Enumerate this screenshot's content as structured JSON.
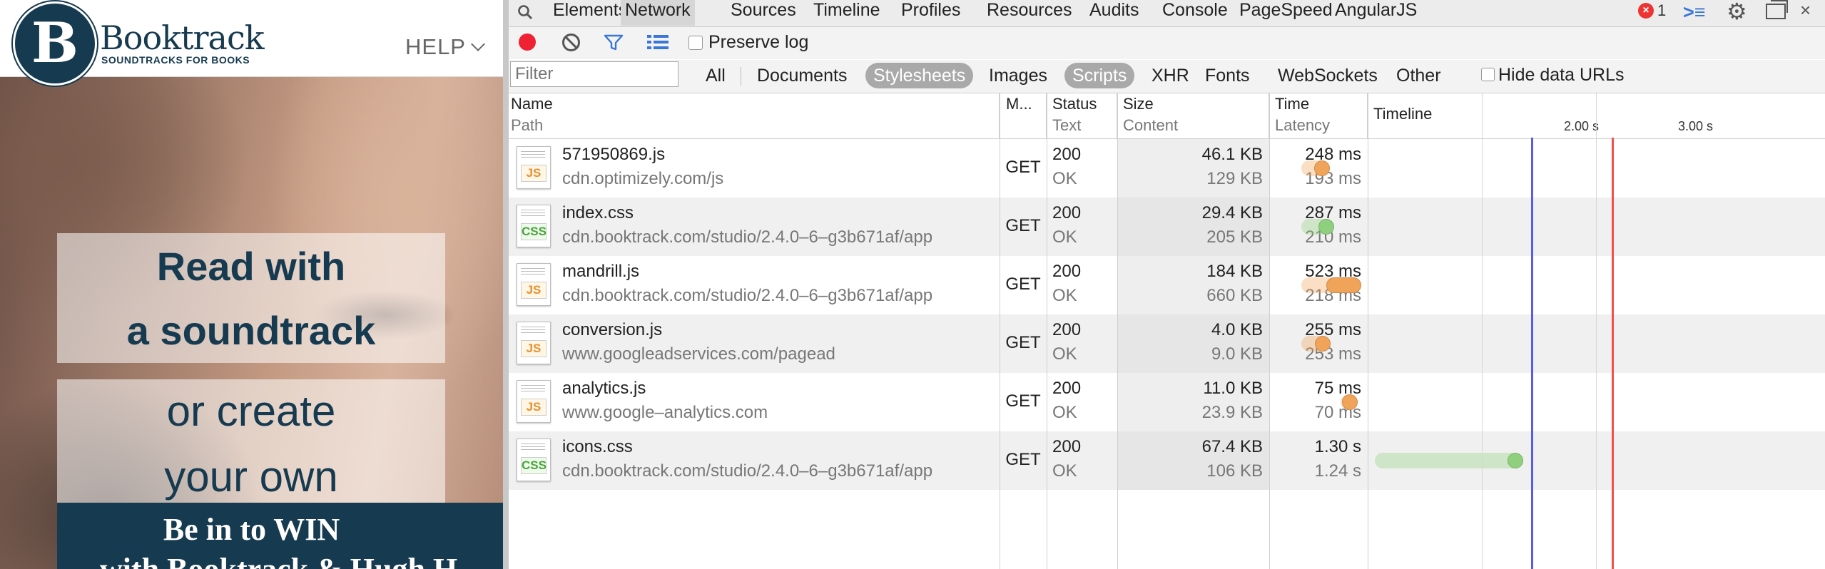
{
  "site": {
    "brand_name": "Booktrack",
    "brand_tagline": "SOUNDTRACKS FOR BOOKS",
    "help_label": "HELP",
    "headline_1": "Read with",
    "headline_2": "a soundtrack",
    "subline_1": "or create",
    "subline_2": "your own",
    "win_line_1": "Be in to WIN",
    "win_line_2": "with Booktrack & Hugh H"
  },
  "devtools": {
    "tabs": [
      "Elements",
      "Network",
      "Sources",
      "Timeline",
      "Profiles",
      "Resources",
      "Audits",
      "Console",
      "PageSpeed",
      "AngularJS"
    ],
    "active_tab": "Network",
    "error_count": "1",
    "preserve_log_label": "Preserve log",
    "filter_placeholder": "Filter",
    "types": [
      "All",
      "Documents",
      "Stylesheets",
      "Images",
      "Scripts",
      "XHR",
      "Fonts",
      "WebSockets",
      "Other"
    ],
    "selected_types": [
      "Stylesheets",
      "Scripts"
    ],
    "hide_data_urls_label": "Hide data URLs",
    "columns": {
      "name": [
        "Name",
        "Path"
      ],
      "method": [
        "M..."
      ],
      "status": [
        "Status",
        "Text"
      ],
      "size": [
        "Size",
        "Content"
      ],
      "time": [
        "Time",
        "Latency"
      ],
      "timeline": [
        "Timeline"
      ]
    },
    "timeline_ticks": [
      "2.00 s",
      "3.00 s"
    ],
    "colors": {
      "js_bar": "#f0a45a",
      "css_bar": "#8fd07e",
      "dom_content_loaded": "#5b5bea",
      "load_event": "#f05050"
    },
    "requests": [
      {
        "name": "571950869.js",
        "path": "cdn.optimizely.com/js",
        "type": "JS",
        "method": "GET",
        "status": "200",
        "status_text": "OK",
        "size": "46.1 KB",
        "content": "129 KB",
        "time": "248 ms",
        "latency": "193 ms",
        "start_s": 0.42,
        "latency_s": 0.193,
        "time_s": 0.248
      },
      {
        "name": "index.css",
        "path": "cdn.booktrack.com/studio/2.4.0–6–g3b671af/app",
        "type": "CSS",
        "method": "GET",
        "status": "200",
        "status_text": "OK",
        "size": "29.4 KB",
        "content": "205 KB",
        "time": "287 ms",
        "latency": "210 ms",
        "start_s": 0.42,
        "latency_s": 0.21,
        "time_s": 0.287
      },
      {
        "name": "mandrill.js",
        "path": "cdn.booktrack.com/studio/2.4.0–6–g3b671af/app",
        "type": "JS",
        "method": "GET",
        "status": "200",
        "status_text": "OK",
        "size": "184 KB",
        "content": "660 KB",
        "time": "523 ms",
        "latency": "218 ms",
        "start_s": 0.42,
        "latency_s": 0.218,
        "time_s": 0.523
      },
      {
        "name": "conversion.js",
        "path": "www.googleadservices.com/pagead",
        "type": "JS",
        "method": "GET",
        "status": "200",
        "status_text": "OK",
        "size": "4.0 KB",
        "content": "9.0 KB",
        "time": "255 ms",
        "latency": "253 ms",
        "start_s": 0.42,
        "latency_s": 0.253,
        "time_s": 0.255
      },
      {
        "name": "analytics.js",
        "path": "www.google–analytics.com",
        "type": "JS",
        "method": "GET",
        "status": "200",
        "status_text": "OK",
        "size": "11.0 KB",
        "content": "23.9 KB",
        "time": "75 ms",
        "latency": "70 ms",
        "start_s": 0.76,
        "latency_s": 0.07,
        "time_s": 0.075
      },
      {
        "name": "icons.css",
        "path": "cdn.booktrack.com/studio/2.4.0–6–g3b671af/app",
        "type": "CSS",
        "method": "GET",
        "status": "200",
        "status_text": "OK",
        "size": "67.4 KB",
        "content": "106 KB",
        "time": "1.30 s",
        "latency": "1.24 s",
        "start_s": 1.06,
        "latency_s": 1.24,
        "time_s": 1.3
      }
    ],
    "dom_content_loaded_s": 2.43,
    "load_event_s": 3.14
  }
}
